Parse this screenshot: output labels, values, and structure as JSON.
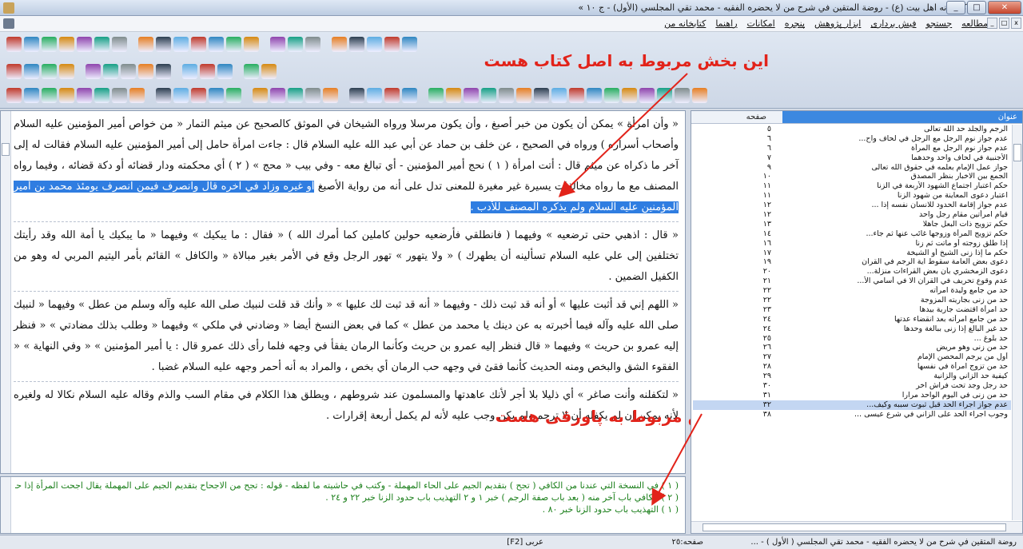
{
  "window": {
    "title": "« كتابخانه اهل بيت (ع) - روضة المتقين في شرح من لا يحضره الفقيه - محمد تقي المجلسي (الأول) - ج ١٠ »",
    "controls": [
      "_",
      "□",
      "✕"
    ]
  },
  "menu": {
    "items": [
      "كتابخانه من",
      "راهنما",
      "امكانات",
      "پنجره",
      "ابزار پژوهش",
      "فيش بردارى",
      "جستجو",
      "مطالعه"
    ],
    "mdi_controls": [
      "x",
      "□",
      "_"
    ]
  },
  "annotations": {
    "top": "اين بخش مربوط به اصل كتاب هست",
    "bottom": "اين بخش مربوط به پاورقى هست"
  },
  "main_text": {
    "paragraphs": [
      {
        "before": "« وأن امرأة » يمكن أن يكون من خبر أصبغ ، وأن يكون مرسلا ورواه الشيخان في الموثق كالصحيح عن ميثم التمار « من خواص أمير المؤمنين عليه السلام وأصحاب أسراره ) ورواه في الصحيح ، عن خلف بن حماد عن أبي عبد الله عليه السلام قال : جاءت امرأة حامل إلى أمير المؤمنين عليه السلام فقالت له إلى آخر ما ذكراه عن ميثم قال : أتت امرأة ( ١ ) نحج أمير المؤمنين - أي تبالغ معه - وفي بيب « محج » ( ٢ ) أي محكمته ودار قضائه أو دكة قضائه ، وفيما رواه المصنف مع ما رواه مخالفات يسيرة غير مغيرة للمعنى تدل على أنه من رواية الأصبغ ",
        "highlight": "أو غيره وزاد في آخره قال وانصرف فيمن انصرف يومئذ محمد بن أمير المؤمنين عليه السلام ولم يذكره المصنف للأدب ."
      },
      {
        "before": "« قال : اذهبي حتى ترضعيه » وفيهما ( فانطلقي فأرضعيه حولين كاملين كما أمرك الله ) « فقال : ما يبكيك » وفيهما « ما يبكيك يا أمة الله وقد رأيتك تختلفين إلى علي عليه السلام تسألينه أن يطهرك ) « ولا يتهور » تهور الرجل وقع في الأمر بغير مبالاة « والكافل » القائم بأمر اليتيم المربي له وهو من الكفيل الضمين .",
        "highlight": ""
      },
      {
        "before": "« اللهم إني قد أثبت عليها » أو أنه قد ثبت ذلك - وفيهما « أنه قد ثبت لك عليها » « وأنك قد قلت لنبيك صلى الله عليه وآله وسلم من عطل » وفيهما « لنبيك صلى الله عليه وآله فيما أخبرته به عن دينك يا محمد من عطل » كما في بعض النسخ أيضا « وضادني في ملكي » وفيهما « وطلب بذلك مضادتي » « فنظر إليه عمرو بن حريث » وفيهما « قال فنظر إليه عمرو بن حريث وكأنما الرمان يفقأ في وجهه فلما رأى ذلك عمرو قال : يا أمير المؤمنين » « وفي النهاية » « الفقوء الشق والبخص ومنه الحديث كأنما فقئ في وجهه حب الرمان أي بخص ، والمراد به أنه أحمر وجهه عليه السلام غضبا .",
        "highlight": ""
      },
      {
        "before": "« لتكفلنه وأنت صاغر » أي ذليلا بلا أجر لأنك عاهدتها والمسلمون عند شروطهم ، ويطلق هذا الكلام في مقام السب والذم وقاله عليه السلام نكالا له ولغيره لأنه يمكن إن لم يكفله أن لا ترجم ولم يكن وجب عليه لأنه لم يكمل أربعة إقرارات .",
        "highlight": ""
      }
    ]
  },
  "footnotes": [
    "( ١ ) في النسخة التي عندنا من الكافي ( تجح ) بتقديم الجيم على الحاء المهملة - وكتب في حاشيته ما لفظه - قوله : تجح من الاجحاح بتقديم الجيم على المهملة يقال اجحت المرأة إذا حملت فاقربت وعظم بطنها فهي مجح . واصل الاجحاح للسباع كذا قاله الجوهري في الصحاح انتهى .",
    "( ٢ ) الكافي باب آخر منه ( بعد باب صفة الرجم ) خبر ١ و ٢ التهذيب باب حدود الزنا خبر ٢٢ و ٢٤ .",
    "( ١ ) التهذيب باب حدود الزنا خبر ٨٠ ."
  ],
  "toc": {
    "col_title": "عنوان",
    "col_page": "صفحه",
    "rows": [
      {
        "t": "الرجم والجلد حد الله تعالى",
        "p": "٥"
      },
      {
        "t": "عدم جواز نوم الرجل مع الرجل في لحاف واح...",
        "p": "٦"
      },
      {
        "t": "عدم جواز نوم الرجل مع المرأة",
        "p": "٦"
      },
      {
        "t": "الأجنبية في لحاف واحد وحدهما",
        "p": "٧"
      },
      {
        "t": "جواز عمل الإمام بعلمه في حقوق الله تعالى",
        "p": "٩"
      },
      {
        "t": "الجمع بين الاخبار بنظر المصدق",
        "p": "١٠"
      },
      {
        "t": "حكم اعتبار اجتماع الشهود الأربعة في الزنا",
        "p": "١١"
      },
      {
        "t": "اعتبار دعوى المعاينة من شهود الزنا",
        "p": "١١"
      },
      {
        "t": "عدم جواز إقامة الحدود للانسان نفسه إذا ...",
        "p": "١٢"
      },
      {
        "t": "قيام امرأتين مقام رجل واحد",
        "p": "١٢"
      },
      {
        "t": "حكم تزويج ذات البعل جاهلا",
        "p": "١٣"
      },
      {
        "t": "حكم تزويج المرأة وزوجها غائب عنها ثم جاء...",
        "p": "١٤"
      },
      {
        "t": "إذا طلق زوجته أو ماتت ثم زنا",
        "p": "١٦"
      },
      {
        "t": "حكم ما إذا زنى الشيخ أو الشيخة",
        "p": "١٧"
      },
      {
        "t": "دعوى بعض العامة سقوط آية الرجم في القرآن",
        "p": "١٩"
      },
      {
        "t": "دعوى الزمخشري بأن بعض القراءات منزلة...",
        "p": "٢٠"
      },
      {
        "t": "عدم وقوع تحريف في القرآن الا في أسامي الأ...",
        "p": "٢١"
      },
      {
        "t": "حد من جامع وليدة امرأته",
        "p": "٢٢"
      },
      {
        "t": "حد من زنى بجاريته المزوجة",
        "p": "٢٢"
      },
      {
        "t": "حد امرأة اقتضت جارية بيدها",
        "p": "٢٣"
      },
      {
        "t": "حد من جامع امرأته بعد انقضاء عدتها",
        "p": "٢٤"
      },
      {
        "t": "حد غير البالغ إذا زنى ببالغة وحدها",
        "p": "٢٤"
      },
      {
        "t": "حد بلوغ ...",
        "p": "٢٥"
      },
      {
        "t": "حد من زنى وهو مريض",
        "p": "٢٦"
      },
      {
        "t": "أول من يرجم المحصن الإمام",
        "p": "٢٧"
      },
      {
        "t": "حد من تزوج امرأة في نفسها",
        "p": "٢٨"
      },
      {
        "t": "كيفية حد الزاني والزانية",
        "p": "٢٩"
      },
      {
        "t": "حد رجل وجد تحت فراش آخر",
        "p": "٣٠"
      },
      {
        "t": "حد من زنى في اليوم الواحد مرارا",
        "p": "٣١"
      },
      {
        "t": "عدم جواز اجراء الحد قبل ثبوت سببه وكيف...",
        "p": "٣٢",
        "sel": true
      },
      {
        "t": "وجوب اجراء الحد على الزاني في شرع عيسى ...",
        "p": "٣٨"
      }
    ]
  },
  "status": {
    "book": "روضة المتقين في شرح من لا يحضره الفقيه - محمد تقي المجلسي ( الأول ) - ...",
    "page": "صفحه:٢٥",
    "lang": "عربى [F2]"
  },
  "colors": {
    "highlight": "#2f7de1",
    "annotation": "#e2231a",
    "footnote_text": "#1b7f1b"
  }
}
